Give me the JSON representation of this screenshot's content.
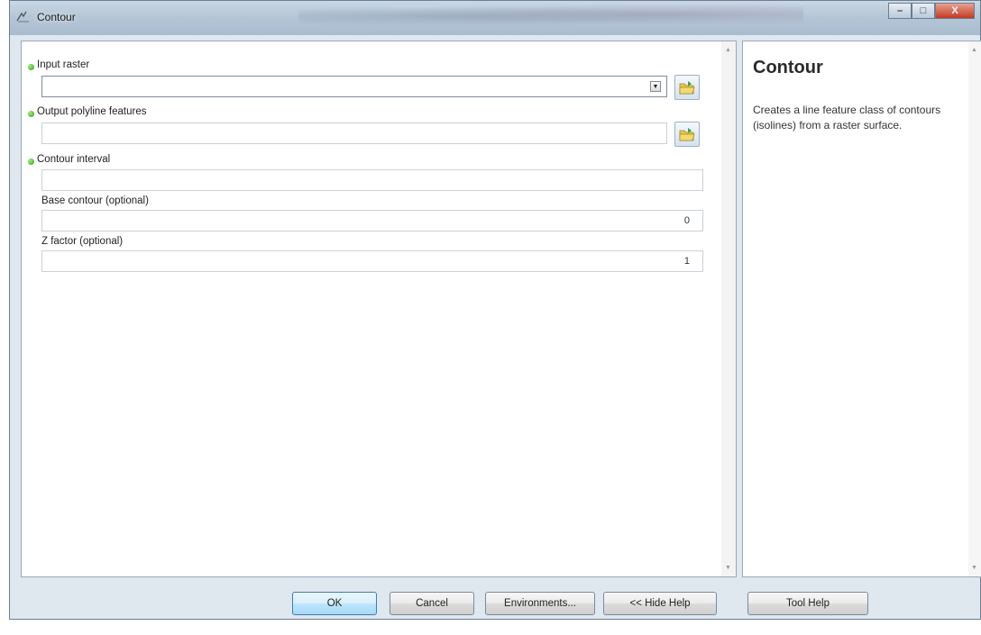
{
  "window": {
    "title": "Contour",
    "controls": {
      "minimize": "–",
      "maximize": "□",
      "close": "X"
    }
  },
  "parameters": [
    {
      "label": "Input raster",
      "required": true,
      "value": ""
    },
    {
      "label": "Output polyline features",
      "required": true,
      "value": ""
    },
    {
      "label": "Contour interval",
      "required": true,
      "value": ""
    },
    {
      "label": "Base contour (optional)",
      "required": false,
      "value": "0"
    },
    {
      "label": "Z factor (optional)",
      "required": false,
      "value": "1"
    }
  ],
  "help": {
    "title": "Contour",
    "description": "Creates a line feature class of contours (isolines) from a raster surface."
  },
  "buttons": {
    "ok": "OK",
    "cancel": "Cancel",
    "environments": "Environments...",
    "hide_help": "<< Hide Help",
    "tool_help": "Tool Help"
  },
  "icons": {
    "app": "contour-tool-icon",
    "required": "green-dot-icon",
    "browse": "browse-folder-icon",
    "dropdown": "chevron-down-icon"
  },
  "colors": {
    "window_bg": "#dfe7ef",
    "required_dot": "#2a9b16",
    "close_button": "#c23a22",
    "ok_button": "#a7d9f5"
  }
}
